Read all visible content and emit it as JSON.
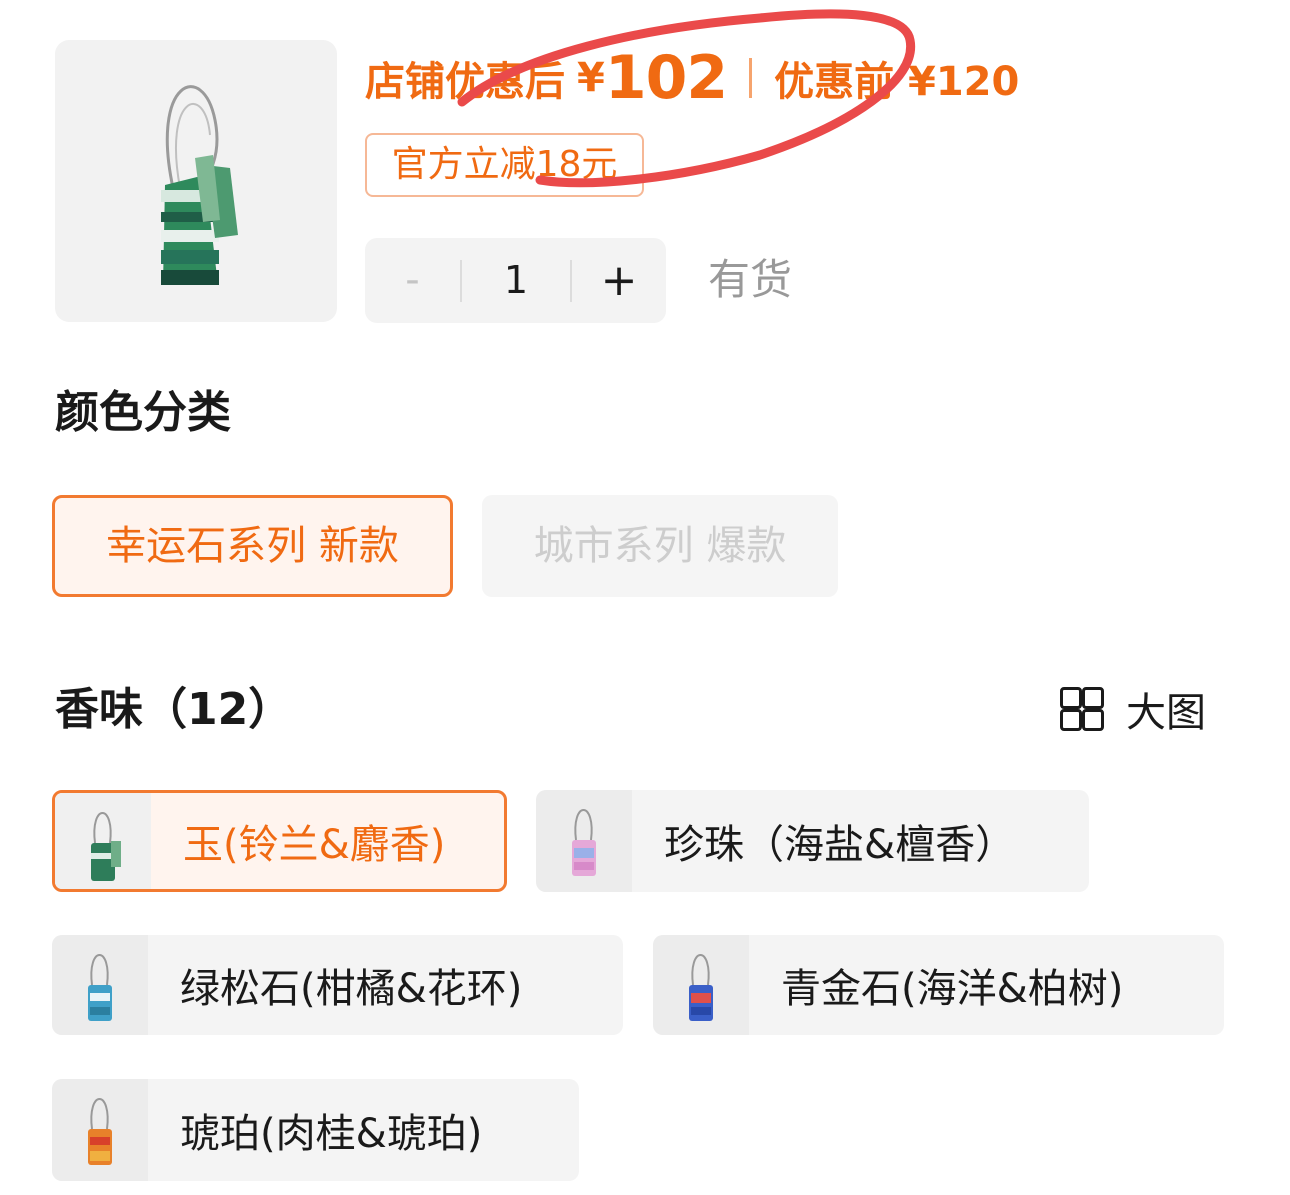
{
  "product": {
    "image_icon": "sachet-product-image",
    "price_label": "店铺优惠后",
    "price_currency": "¥",
    "price_value": "102",
    "original_label": "优惠前 ¥120",
    "discount_tag": "官方立减18元",
    "quantity": "1",
    "minus": "-",
    "plus": "+",
    "stock": "有货"
  },
  "color_section": {
    "title": "颜色分类",
    "options": [
      {
        "label": "幸运石系列 新款",
        "state": "selected"
      },
      {
        "label": "城市系列 爆款",
        "state": "disabled"
      }
    ]
  },
  "scent_section": {
    "title": "香味（12）",
    "view_toggle_icon": "grid-view-icon",
    "view_toggle_label": "大图",
    "options": [
      {
        "label": "玉(铃兰&麝香)",
        "selected": true
      },
      {
        "label": "珍珠（海盐&檀香）",
        "selected": false
      },
      {
        "label": "绿松石(柑橘&花环)",
        "selected": false
      },
      {
        "label": "青金石(海洋&柏树)",
        "selected": false
      },
      {
        "label": "琥珀(肉桂&琥珀)",
        "selected": false
      }
    ]
  },
  "colors": {
    "accent": "#f06a12",
    "selected_border": "#f27a30",
    "annotation_red": "#ea4a4a"
  }
}
